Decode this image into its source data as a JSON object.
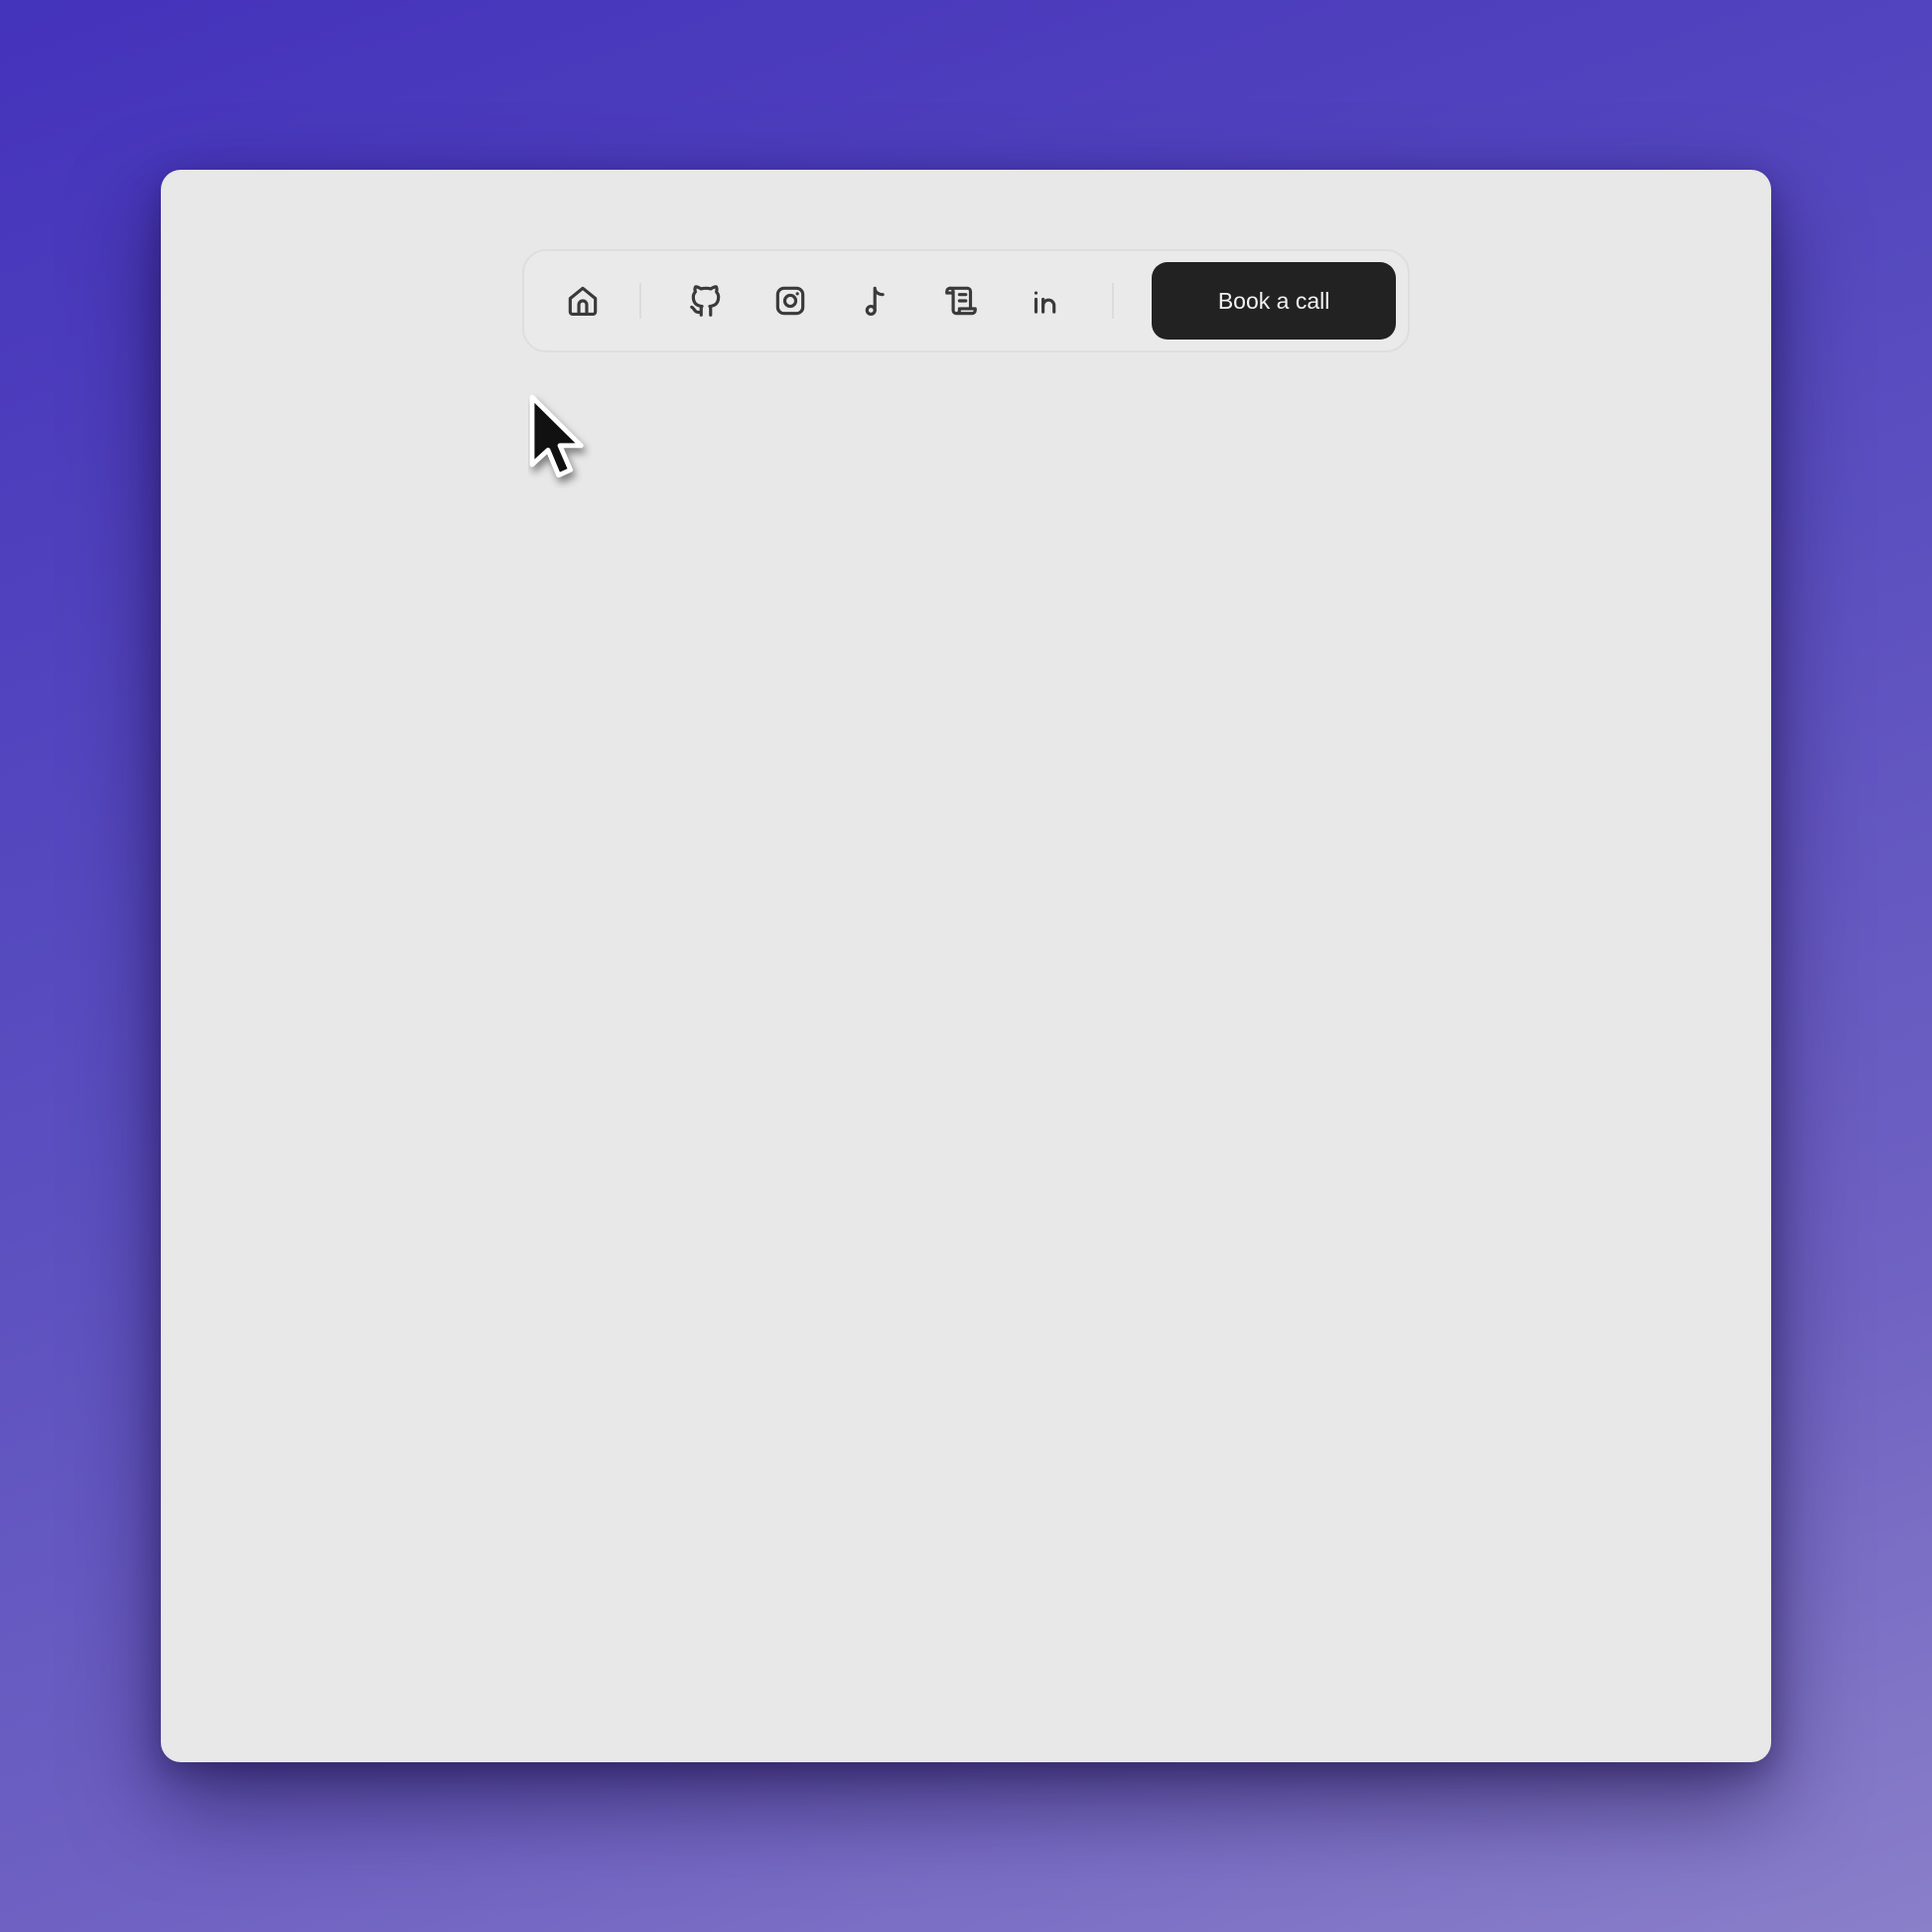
{
  "navbar": {
    "icons": [
      {
        "name": "home-icon"
      },
      {
        "name": "github-icon"
      },
      {
        "name": "instagram-icon"
      },
      {
        "name": "music-note-icon"
      },
      {
        "name": "scroll-icon"
      },
      {
        "name": "linkedin-icon"
      }
    ],
    "cta_label": "Book a call"
  },
  "colors": {
    "background_start": "#4433bb",
    "background_end": "#8a7fc9",
    "window": "#e8e8e8",
    "button": "#222222",
    "button_text": "#f2f2f2",
    "icon_stroke": "#3a3a3a"
  }
}
